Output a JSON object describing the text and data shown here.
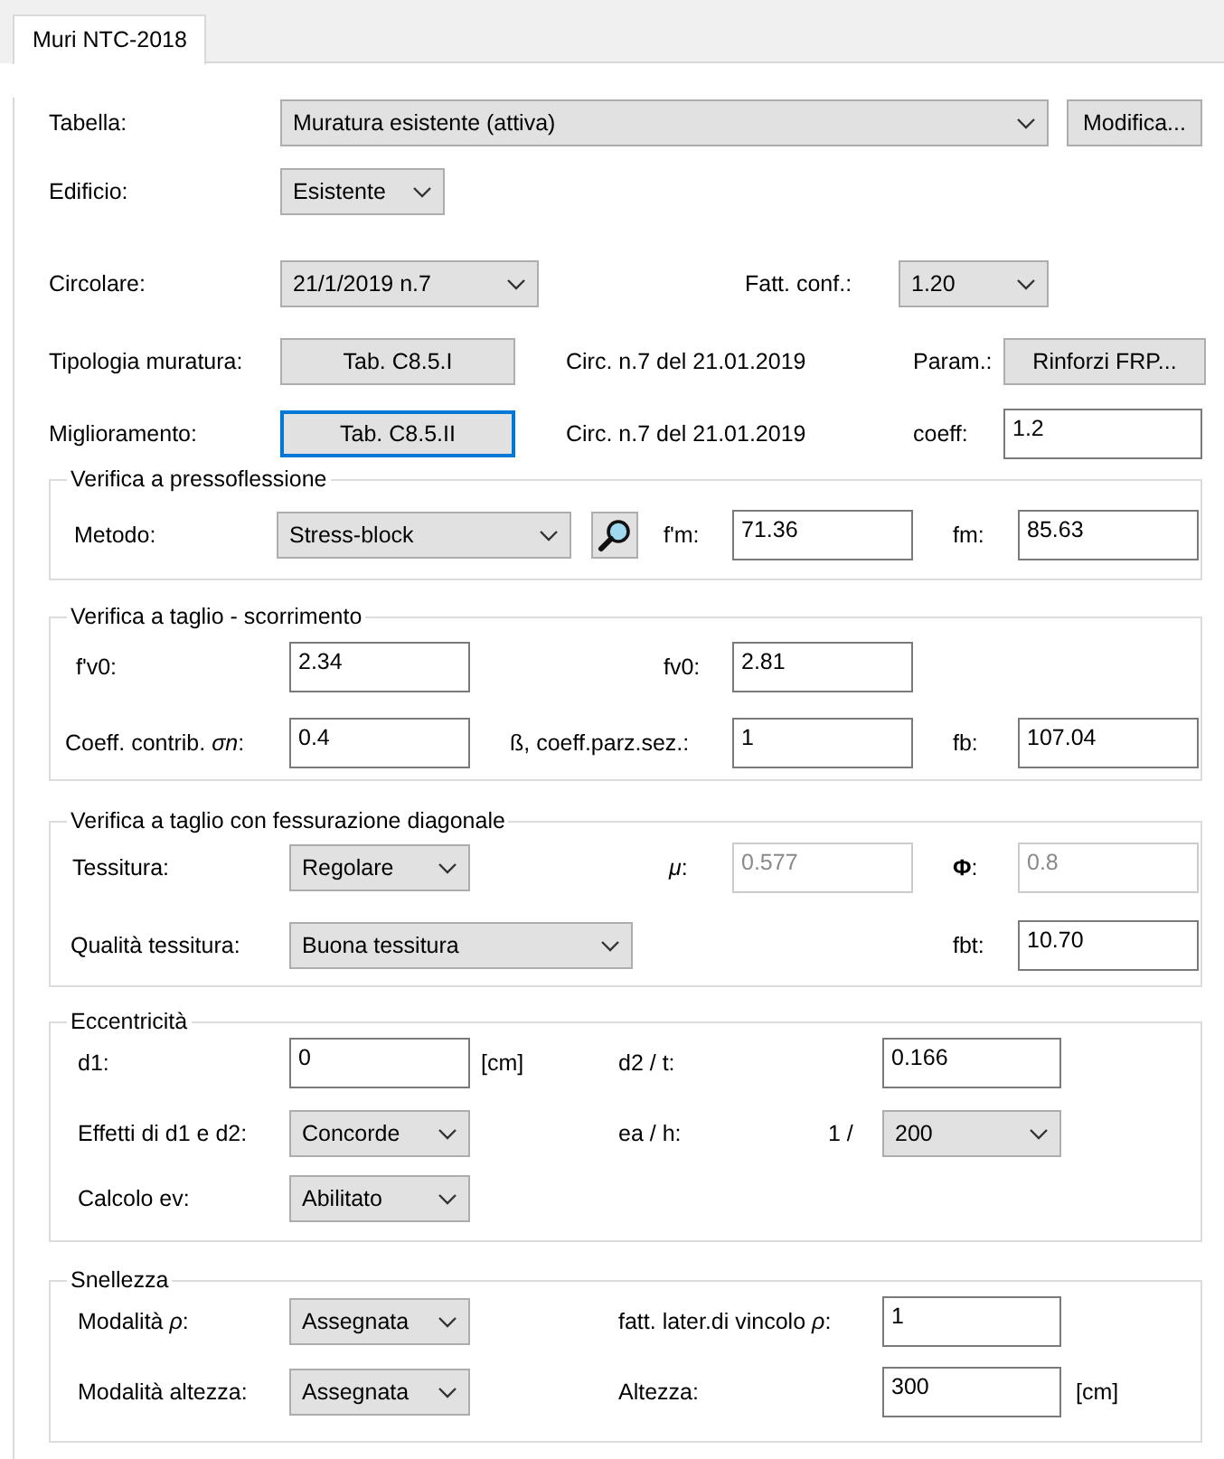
{
  "tabs": [
    {
      "label": "Muri NTC-2018",
      "selected": true
    }
  ],
  "header_rows": [
    [
      {
        "kind": "label",
        "text": "Tabella:"
      },
      {
        "kind": "select",
        "value": "Muratura esistente (attiva)"
      },
      {
        "kind": "button",
        "label": "Modifica...",
        "focused": false
      }
    ],
    [
      {
        "kind": "label",
        "text": "Edificio:"
      },
      {
        "kind": "select",
        "value": "Esistente"
      }
    ],
    [
      {
        "kind": "label",
        "text": "Circolare:"
      },
      {
        "kind": "select",
        "value": "21/1/2019 n.7"
      },
      {
        "kind": "label",
        "text": "Fatt. conf.:"
      },
      {
        "kind": "select",
        "value": "1.20"
      }
    ],
    [
      {
        "kind": "label",
        "text": "Tipologia muratura:"
      },
      {
        "kind": "button",
        "label": "Tab. C8.5.I",
        "focused": false
      },
      {
        "kind": "note",
        "text": "Circ. n.7 del 21.01.2019"
      },
      {
        "kind": "label",
        "text": "Param.:"
      },
      {
        "kind": "button",
        "label": "Rinforzi FRP...",
        "focused": false
      }
    ],
    [
      {
        "kind": "label",
        "text": "Miglioramento:"
      },
      {
        "kind": "button",
        "label": "Tab. C8.5.II",
        "focused": true
      },
      {
        "kind": "note",
        "text": "Circ. n.7 del 21.01.2019"
      },
      {
        "kind": "label",
        "text": "coeff:"
      },
      {
        "kind": "input",
        "value": "1.2",
        "disabled": false
      }
    ]
  ],
  "groups": [
    {
      "title": "Verifica a pressoflessione",
      "rows": [
        [
          {
            "kind": "label",
            "text": "Metodo:"
          },
          {
            "kind": "select",
            "value": "Stress-block"
          },
          {
            "kind": "search_button"
          },
          {
            "kind": "label",
            "text": "f'm:"
          },
          {
            "kind": "input",
            "value": "71.36",
            "disabled": false
          },
          {
            "kind": "label",
            "text": "fm:"
          },
          {
            "kind": "input",
            "value": "85.63",
            "disabled": false
          }
        ]
      ]
    },
    {
      "title": "Verifica a taglio - scorrimento",
      "rows": [
        [
          {
            "kind": "label",
            "text": "f'v0:"
          },
          {
            "kind": "input",
            "value": "2.34",
            "disabled": false
          },
          {
            "kind": "label",
            "text": "fv0:"
          },
          {
            "kind": "input",
            "value": "2.81",
            "disabled": false
          }
        ],
        [
          {
            "kind": "label",
            "text": "Coeff. contrib. *σn*:"
          },
          {
            "kind": "input",
            "value": "0.4",
            "disabled": false
          },
          {
            "kind": "label",
            "text": "ß, coeff.parz.sez.:"
          },
          {
            "kind": "input",
            "value": "1",
            "disabled": false
          },
          {
            "kind": "label",
            "text": "fb:"
          },
          {
            "kind": "input",
            "value": "107.04",
            "disabled": false
          }
        ]
      ]
    },
    {
      "title": "Verifica a taglio con fessurazione diagonale",
      "rows": [
        [
          {
            "kind": "label",
            "text": "Tessitura:"
          },
          {
            "kind": "select",
            "value": "Regolare"
          },
          {
            "kind": "label",
            "text": "*μ*:"
          },
          {
            "kind": "input",
            "value": "0.577",
            "disabled": true
          },
          {
            "kind": "label",
            "text": "**Φ**:"
          },
          {
            "kind": "input",
            "value": "0.8",
            "disabled": true
          }
        ],
        [
          {
            "kind": "label",
            "text": "Qualità tessitura:"
          },
          {
            "kind": "select",
            "value": "Buona tessitura"
          },
          "",
          "",
          {
            "kind": "label",
            "text": "fbt:"
          },
          {
            "kind": "input",
            "value": "10.70",
            "disabled": false
          }
        ]
      ]
    },
    {
      "title": "Eccentricità",
      "rows": [
        [
          {
            "kind": "label",
            "text": "d1:"
          },
          {
            "kind": "input",
            "value": "0",
            "disabled": false
          },
          {
            "kind": "unit",
            "text": "[cm]"
          },
          {
            "kind": "label",
            "text": "d2 / t:"
          },
          "",
          {
            "kind": "input",
            "value": "0.166",
            "disabled": false
          }
        ],
        [
          {
            "kind": "label",
            "text": "Effetti di d1 e d2:"
          },
          {
            "kind": "select",
            "value": "Concorde"
          },
          "",
          {
            "kind": "label",
            "text": "ea / h:"
          },
          {
            "kind": "unit",
            "text": "1 /"
          },
          {
            "kind": "select",
            "value": "200"
          }
        ],
        [
          {
            "kind": "label",
            "text": "Calcolo ev:"
          },
          {
            "kind": "select",
            "value": "Abilitato"
          }
        ]
      ]
    },
    {
      "title": "Snellezza",
      "rows": [
        [
          {
            "kind": "label",
            "text": "Modalità  *ρ*:"
          },
          {
            "kind": "select",
            "value": "Assegnata"
          },
          "",
          {
            "kind": "label",
            "text": "fatt. later.di vincolo *ρ*:"
          },
          "",
          {
            "kind": "input",
            "value": "1",
            "disabled": false
          }
        ],
        [
          {
            "kind": "label",
            "text": "Modalità altezza:"
          },
          {
            "kind": "select",
            "value": "Assegnata"
          },
          "",
          {
            "kind": "label",
            "text": "Altezza:"
          },
          "",
          {
            "kind": "input",
            "value": "300",
            "disabled": false
          },
          {
            "kind": "unit",
            "text": "[cm]"
          }
        ]
      ]
    }
  ]
}
